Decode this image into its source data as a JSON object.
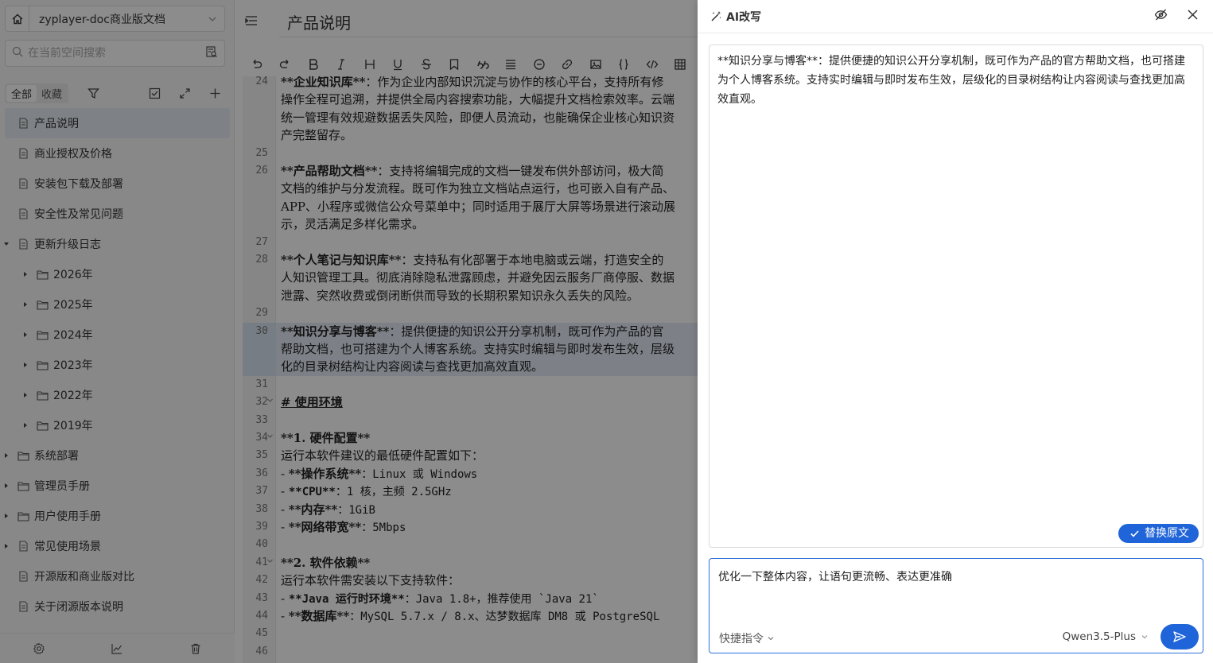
{
  "sidebar": {
    "space_name": "zyplayer-doc商业版文档",
    "search_placeholder": "在当前空间搜索",
    "tabs": [
      "全部",
      "收藏"
    ],
    "tree": [
      {
        "label": "产品说明",
        "type": "doc",
        "level": 0,
        "selected": true
      },
      {
        "label": "商业授权及价格",
        "type": "doc",
        "level": 0
      },
      {
        "label": "安装包下载及部署",
        "type": "doc",
        "level": 0
      },
      {
        "label": "安全性及常见问题",
        "type": "doc",
        "level": 0
      },
      {
        "label": "更新升级日志",
        "type": "doc",
        "level": 0,
        "expanded": true
      },
      {
        "label": "2026年",
        "type": "folder",
        "level": 1
      },
      {
        "label": "2025年",
        "type": "folder",
        "level": 1
      },
      {
        "label": "2024年",
        "type": "folder",
        "level": 1
      },
      {
        "label": "2023年",
        "type": "folder",
        "level": 1
      },
      {
        "label": "2022年",
        "type": "folder",
        "level": 1
      },
      {
        "label": "2019年",
        "type": "folder",
        "level": 1
      },
      {
        "label": "系统部署",
        "type": "folder",
        "level": 0
      },
      {
        "label": "管理员手册",
        "type": "folder",
        "level": 0
      },
      {
        "label": "用户使用手册",
        "type": "folder",
        "level": 0
      },
      {
        "label": "常见使用场景",
        "type": "doc",
        "level": 0,
        "collapsed": true
      },
      {
        "label": "开源版和商业版对比",
        "type": "doc",
        "level": 0
      },
      {
        "label": "关于闭源版本说明",
        "type": "doc",
        "level": 0
      }
    ]
  },
  "editor": {
    "title": "产品说明",
    "toolbar_icons": [
      "undo-icon",
      "redo-icon",
      "bold-icon",
      "italic-icon",
      "heading-icon",
      "underline-icon",
      "strikethrough-icon",
      "bookmark-icon",
      "quote-icon",
      "list-icon",
      "emoji-icon",
      "link-icon",
      "image-icon",
      "code-block-icon",
      "code-icon",
      "table-icon",
      "location-icon"
    ],
    "lines": [
      {
        "n": "24",
        "parts": [
          [
            "b",
            "**企业知识库**"
          ],
          [
            "t",
            "：作为企业内部知识沉淀与协作的核心平台，支持所有修"
          ]
        ]
      },
      {
        "n": "",
        "parts": [
          [
            "t",
            "操作全程可追溯，并提供全局内容搜索功能，大幅提升文档检索效率。云端"
          ]
        ]
      },
      {
        "n": "",
        "parts": [
          [
            "t",
            "统一管理有效规避数据丢失风险，即便人员流动，也能确保企业核心知识资"
          ]
        ]
      },
      {
        "n": "",
        "parts": [
          [
            "t",
            "产完整留存。"
          ]
        ]
      },
      {
        "n": "25",
        "parts": []
      },
      {
        "n": "26",
        "parts": [
          [
            "b",
            "**产品帮助文档**"
          ],
          [
            "t",
            "：支持将编辑完成的文档一键发布供外部访问，极大简"
          ]
        ]
      },
      {
        "n": "",
        "parts": [
          [
            "t",
            "文档的维护与分发流程。既可作为独立文档站点运行，也可嵌入自有产品、"
          ]
        ]
      },
      {
        "n": "",
        "parts": [
          [
            "t",
            "APP、小程序或微信公众号菜单中；同时适用于展厅大屏等场景进行滚动展"
          ]
        ]
      },
      {
        "n": "",
        "parts": [
          [
            "t",
            "示，灵活满足多样化需求。"
          ]
        ]
      },
      {
        "n": "27",
        "parts": []
      },
      {
        "n": "28",
        "parts": [
          [
            "b",
            "**个人笔记与知识库**"
          ],
          [
            "t",
            "：支持私有化部署于本地电脑或云端，打造安全的"
          ]
        ]
      },
      {
        "n": "",
        "parts": [
          [
            "t",
            "人知识管理工具。彻底消除隐私泄露顾虑，并避免因云服务厂商停服、数据"
          ]
        ]
      },
      {
        "n": "",
        "parts": [
          [
            "t",
            "泄露、突然收费或倒闭断供而导致的长期积累知识永久丢失的风险。"
          ]
        ]
      },
      {
        "n": "29",
        "parts": []
      },
      {
        "n": "30",
        "parts": [
          [
            "b",
            "**知识分享与博客**"
          ],
          [
            "t",
            "：提供便捷的知识公开分享机制，既可作为产品的官"
          ]
        ]
      },
      {
        "n": "",
        "parts": [
          [
            "t",
            "帮助文档，也可搭建为个人博客系统。支持实时编辑与即时发布生效，层级"
          ]
        ]
      },
      {
        "n": "",
        "parts": [
          [
            "t",
            "化的目录树结构让内容阅读与查找更加高效直观。"
          ]
        ]
      },
      {
        "n": "31",
        "parts": []
      },
      {
        "n": "32",
        "parts": [
          [
            "b",
            "# 使用环境"
          ]
        ],
        "fold": true,
        "heading": true
      },
      {
        "n": "33",
        "parts": []
      },
      {
        "n": "34",
        "parts": [
          [
            "b",
            "**1. 硬件配置**"
          ]
        ],
        "fold": true
      },
      {
        "n": "35",
        "parts": [
          [
            "t",
            "运行本软件建议的最低硬件配置如下："
          ]
        ]
      },
      {
        "n": "36",
        "parts": [
          [
            "t",
            "- "
          ],
          [
            "b",
            "**操作系统**"
          ],
          [
            "t",
            "：Linux 或 Windows"
          ]
        ]
      },
      {
        "n": "37",
        "parts": [
          [
            "t",
            "- "
          ],
          [
            "b",
            "**CPU**"
          ],
          [
            "t",
            "：1 核，主频 2.5GHz"
          ]
        ]
      },
      {
        "n": "38",
        "parts": [
          [
            "t",
            "- "
          ],
          [
            "b",
            "**内存**"
          ],
          [
            "t",
            "：1GiB"
          ]
        ]
      },
      {
        "n": "39",
        "parts": [
          [
            "t",
            "- "
          ],
          [
            "b",
            "**网络带宽**"
          ],
          [
            "t",
            "：5Mbps"
          ]
        ]
      },
      {
        "n": "40",
        "parts": []
      },
      {
        "n": "41",
        "parts": [
          [
            "b",
            "**2. 软件依赖**"
          ]
        ],
        "fold": true
      },
      {
        "n": "42",
        "parts": [
          [
            "t",
            "运行本软件需安装以下支持软件："
          ]
        ]
      },
      {
        "n": "43",
        "parts": [
          [
            "t",
            "- "
          ],
          [
            "b",
            "**Java 运行时环境**"
          ],
          [
            "t",
            "：Java 1.8+，推荐使用 `Java 21`"
          ]
        ]
      },
      {
        "n": "44",
        "parts": [
          [
            "t",
            "- "
          ],
          [
            "b",
            "**数据库**"
          ],
          [
            "t",
            "：MySQL 5.7.x / 8.x、达梦数据库 DM8 或 PostgreSQL"
          ]
        ]
      },
      {
        "n": "45",
        "parts": []
      },
      {
        "n": "46",
        "parts": []
      }
    ]
  },
  "ai_panel": {
    "title": "AI改写",
    "result_text": "**知识分享与博客**：提供便捷的知识公开分享机制，既可作为产品的官方帮助文档，也可搭建为个人博客系统。支持实时编辑与即时发布生效，层级化的目录树结构让内容阅读与查找更加高效直观。",
    "replace_label": "替换原文",
    "prompt_value": "优化一下整体内容，让语句更流畅、表达更准确",
    "quick_label": "快捷指令",
    "model_label": "Qwen3.5-Plus"
  },
  "colors": {
    "accent": "#1f64d8",
    "highlight": "#e4ecf6",
    "sidebar_bg": "#f7f7f7"
  }
}
